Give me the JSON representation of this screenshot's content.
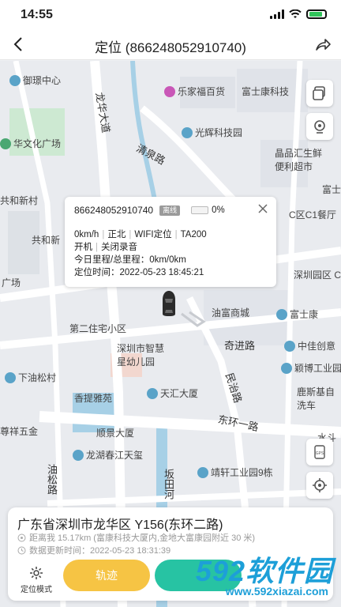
{
  "status_bar": {
    "time": "14:55"
  },
  "header": {
    "title": "定位 (866248052910740)"
  },
  "map_labels": [
    {
      "name": "poi-yushuzhongxin",
      "text": "御璟中心",
      "poi": "blue"
    },
    {
      "name": "road-longhua",
      "text": "龙华大道",
      "poi": ""
    },
    {
      "name": "poi-lejiafu",
      "text": "乐家福百货",
      "poi": "pink"
    },
    {
      "name": "poi-fushikang-top",
      "text": "富士康科技",
      "poi": ""
    },
    {
      "name": "poi-huawenhua",
      "text": "华文化广场",
      "poi": "green"
    },
    {
      "name": "poi-guanghui",
      "text": "光辉科技园",
      "poi": "blue"
    },
    {
      "name": "road-qingquan",
      "text": "清泉路",
      "poi": ""
    },
    {
      "name": "poi-pinjing",
      "text": "晶品汇生鲜\n便利超市",
      "poi": "pink"
    },
    {
      "name": "poi-gongheixincun",
      "text": "共和新村",
      "poi": ""
    },
    {
      "name": "poi-fu-right",
      "text": "富士",
      "poi": ""
    },
    {
      "name": "poi-gonghe",
      "text": "共和新",
      "poi": ""
    },
    {
      "name": "poi-cc1",
      "text": "C区C1餐厅",
      "poi": ""
    },
    {
      "name": "poi-guangchang",
      "text": "广场",
      "poi": ""
    },
    {
      "name": "poi-shenzhenyuan",
      "text": "深圳园区 C",
      "poi": ""
    },
    {
      "name": "poi-youfu",
      "text": "油富商城",
      "poi": "blue"
    },
    {
      "name": "poi-fushikang-2",
      "text": "富士康",
      "poi": "blue"
    },
    {
      "name": "poi-dierzhuzhai",
      "text": "第二住宅小区",
      "poi": ""
    },
    {
      "name": "road-qijin",
      "text": "奇进路",
      "poi": ""
    },
    {
      "name": "poi-zhongjia",
      "text": "中佳创意",
      "poi": "blue"
    },
    {
      "name": "poi-zhihui",
      "text": "深圳市智慧\n星幼儿园",
      "poi": "green"
    },
    {
      "name": "poi-yingbo",
      "text": "颖博工业园",
      "poi": "blue"
    },
    {
      "name": "poi-xiayousong",
      "text": "下油松村",
      "poi": "blue"
    },
    {
      "name": "road-minzhi",
      "text": "民治路",
      "poi": ""
    },
    {
      "name": "poi-xiangti",
      "text": "香提雅苑",
      "poi": ""
    },
    {
      "name": "poi-tianhui",
      "text": "天汇大厦",
      "poi": "blue"
    },
    {
      "name": "poi-lufei",
      "text": "鹿斯基自\n洗车",
      "poi": ""
    },
    {
      "name": "poi-zunxiang",
      "text": "尊祥五金",
      "poi": ""
    },
    {
      "name": "road-donghuan1",
      "text": "东环一路",
      "poi": ""
    },
    {
      "name": "poi-shunjing",
      "text": "顺景大厦",
      "poi": ""
    },
    {
      "name": "poi-shuishan",
      "text": "水斗",
      "poi": ""
    },
    {
      "name": "poi-longhu",
      "text": "龙湖春江天玺",
      "poi": "blue"
    },
    {
      "name": "road-bantian",
      "text": "坂田河",
      "poi": ""
    },
    {
      "name": "poi-jingxuan",
      "text": "靖轩工业园9栋",
      "poi": "blue"
    },
    {
      "name": "road-youxin",
      "text": "油松路",
      "poi": ""
    }
  ],
  "popup": {
    "imei": "866248052910740",
    "badge": "离线",
    "battery": "0%",
    "line1": [
      "0km/h",
      "正北",
      "WIFI定位",
      "TA200"
    ],
    "line2": [
      "开机",
      "关闭录音"
    ],
    "mileage": "今日里程/总里程：0km/0km",
    "time": "定位时间：2022-05-23 18:45:21"
  },
  "panel": {
    "address": "广东省深圳市龙华区 Y156(东环二路)",
    "distance": "距离我 15.17km (富康科技大厦内,金地大富康园附近 30 米)",
    "updated": "数据更新时间：2022-05-23 18:31:39",
    "mode_label": "定位模式",
    "track_label": "轨迹"
  },
  "watermark": {
    "brand": "592软件园",
    "url": "www.592xiazai.com"
  },
  "colors": {
    "accent_yellow": "#f6c444",
    "accent_green": "#27c3a3",
    "water": "#a7d0e6",
    "road": "#ffffff",
    "park": "#cde9d2"
  }
}
